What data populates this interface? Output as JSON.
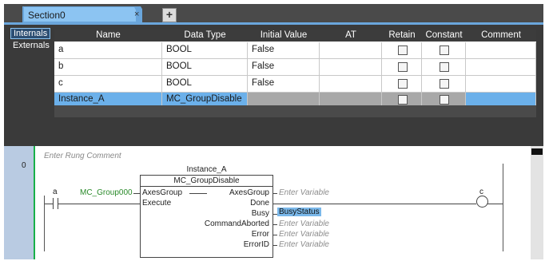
{
  "tab": {
    "label": "Section0",
    "close": "×",
    "add": "+"
  },
  "side_tabs": [
    "Internals",
    "Externals"
  ],
  "table": {
    "headers": [
      "Name",
      "Data Type",
      "Initial Value",
      "AT",
      "Retain",
      "Constant",
      "Comment"
    ],
    "rows": [
      {
        "name": "a",
        "type": "BOOL",
        "init": "False",
        "selected": false
      },
      {
        "name": "b",
        "type": "BOOL",
        "init": "False",
        "selected": false
      },
      {
        "name": "c",
        "type": "BOOL",
        "init": "False",
        "selected": false
      },
      {
        "name": "Instance_A",
        "type": "MC_GroupDisable",
        "init": "",
        "selected": true
      }
    ]
  },
  "ladder": {
    "rung_number": "0",
    "rung_comment": "Enter Rung Comment",
    "contact_label": "a",
    "instance_name": "Instance_A",
    "fb_type": "MC_GroupDisable",
    "axes_input": "MC_Group000",
    "inputs": [
      "AxesGroup",
      "Execute"
    ],
    "outputs": [
      "AxesGroup",
      "Done",
      "Busy",
      "CommandAborted",
      "Error",
      "ErrorID"
    ],
    "output_vars": [
      "Enter Variable",
      "",
      "BusyStatus",
      "Enter Variable",
      "Enter Variable",
      "Enter Variable"
    ],
    "coil_label": "c"
  }
}
